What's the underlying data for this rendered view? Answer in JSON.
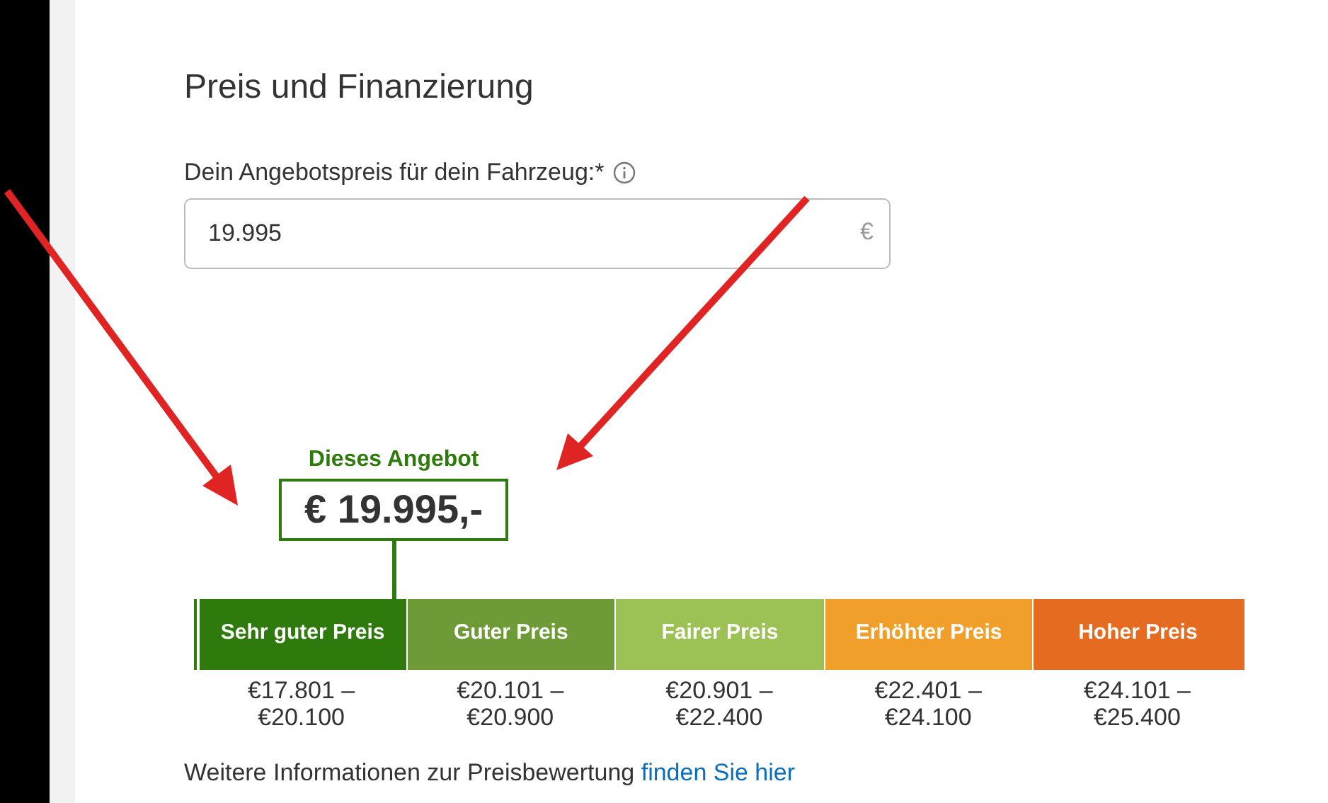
{
  "section_title": "Preis und Finanzierung",
  "price_field": {
    "label": "Dein Angebotspreis für dein Fahrzeug:*",
    "value": "19.995",
    "unit": "€"
  },
  "offer_marker": {
    "caption": "Dieses Angebot",
    "price": "€ 19.995,-"
  },
  "price_scale": [
    {
      "label": "Sehr guter Preis",
      "range_lines": [
        "€17.801 –",
        "€20.100"
      ],
      "color": "#2e7a0c",
      "selected": true
    },
    {
      "label": "Guter Preis",
      "range_lines": [
        "€20.101 –",
        "€20.900"
      ],
      "color": "#6e9a37",
      "selected": false
    },
    {
      "label": "Fairer Preis",
      "range_lines": [
        "€20.901 –",
        "€22.400"
      ],
      "color": "#9cc155",
      "selected": false
    },
    {
      "label": "Erhöhter Preis",
      "range_lines": [
        "€22.401 –",
        "€24.100"
      ],
      "color": "#f0a02a",
      "selected": false
    },
    {
      "label": "Hoher Preis",
      "range_lines": [
        "€24.101 –",
        "€25.400"
      ],
      "color": "#e46b1f",
      "selected": false
    }
  ],
  "footer": {
    "text": "Weitere Informationen zur Preisbewertung",
    "link": "finden Sie hier"
  }
}
